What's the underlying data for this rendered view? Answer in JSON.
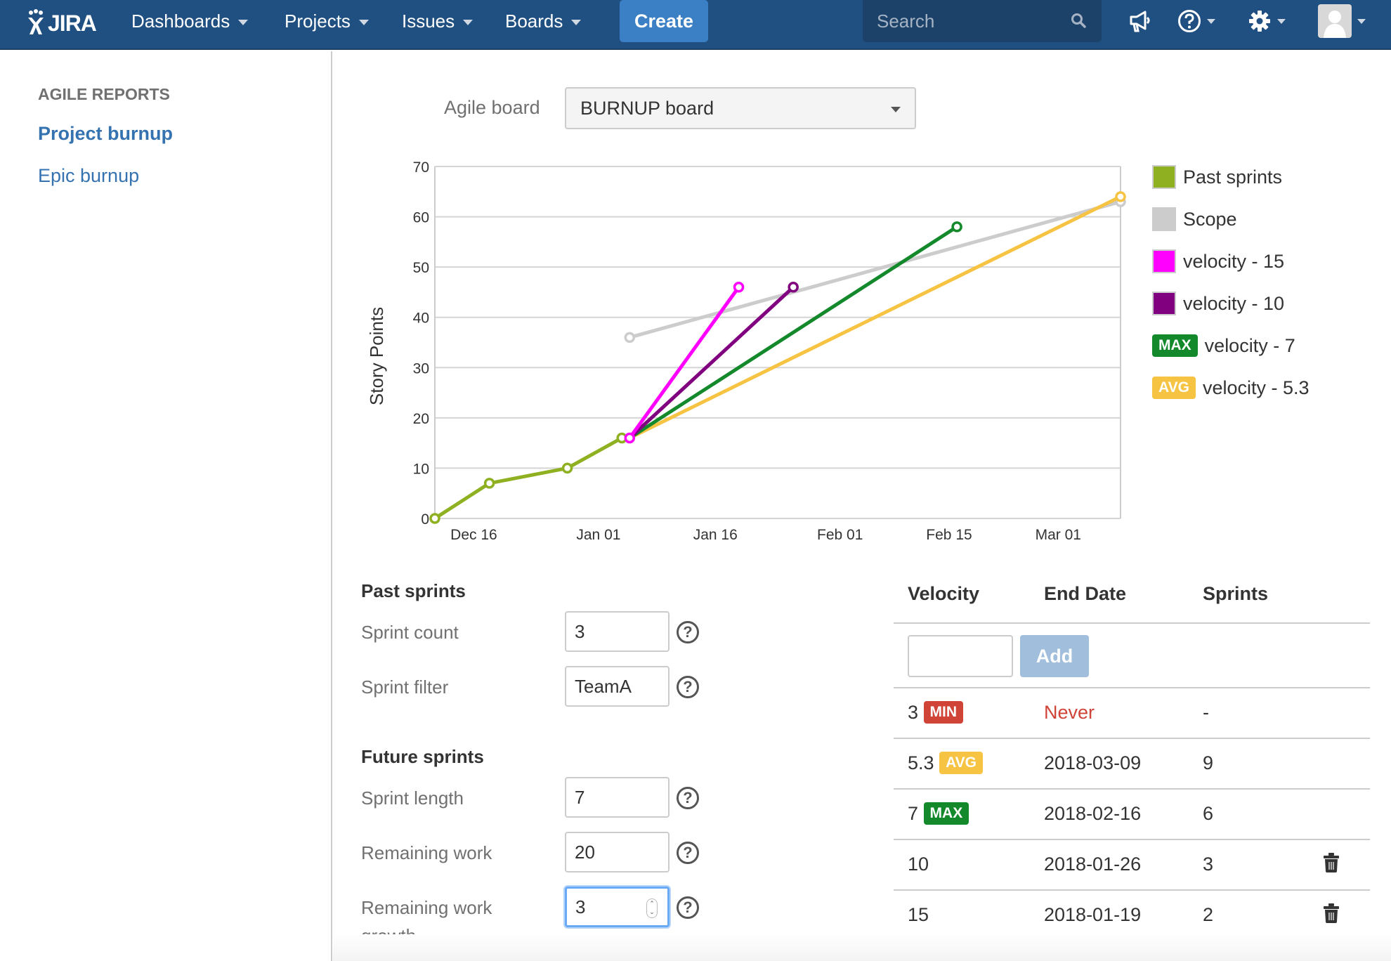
{
  "header": {
    "logo": "JIRA",
    "nav": [
      {
        "label": "Dashboards"
      },
      {
        "label": "Projects"
      },
      {
        "label": "Issues"
      },
      {
        "label": "Boards"
      }
    ],
    "create_label": "Create",
    "search_placeholder": "Search",
    "icons": [
      "megaphone-icon",
      "help-icon",
      "gear-icon",
      "avatar"
    ]
  },
  "sidebar": {
    "heading": "AGILE REPORTS",
    "items": [
      {
        "label": "Project burnup",
        "active": true
      },
      {
        "label": "Epic burnup",
        "active": false
      }
    ]
  },
  "board": {
    "label": "Agile board",
    "selected": "BURNUP board"
  },
  "legend": [
    {
      "label": "Past sprints",
      "color": "#8eb021"
    },
    {
      "label": "Scope",
      "color": "#cccccc"
    },
    {
      "label": "velocity - 15",
      "color": "#ff00ff"
    },
    {
      "label": "velocity - 10",
      "color": "#800080"
    },
    {
      "label": "velocity - 7",
      "badge": "MAX",
      "color": "#14892c"
    },
    {
      "label": "velocity - 5.3",
      "badge": "AVG",
      "color": "#f6c342"
    }
  ],
  "chart_data": {
    "type": "line",
    "title": "",
    "xlabel": "",
    "ylabel": "Story Points",
    "ylim": [
      0,
      70
    ],
    "yticks": [
      0,
      10,
      20,
      30,
      40,
      50,
      60,
      70
    ],
    "xlim": [
      "2017-12-11",
      "2018-03-09"
    ],
    "xticks": [
      {
        "label": "Dec 16",
        "date": "2017-12-16"
      },
      {
        "label": "Jan 01",
        "date": "2018-01-01"
      },
      {
        "label": "Jan 16",
        "date": "2018-01-16"
      },
      {
        "label": "Feb 01",
        "date": "2018-02-01"
      },
      {
        "label": "Feb 15",
        "date": "2018-02-15"
      },
      {
        "label": "Mar 01",
        "date": "2018-03-01"
      }
    ],
    "grid": true,
    "legend_position": "right",
    "series": [
      {
        "name": "Past sprints",
        "color": "#8eb021",
        "points": [
          [
            "2017-12-11",
            0
          ],
          [
            "2017-12-18",
            7
          ],
          [
            "2017-12-28",
            10
          ],
          [
            "2018-01-04",
            16
          ]
        ]
      },
      {
        "name": "Scope",
        "color": "#cccccc",
        "points": [
          [
            "2018-01-05",
            36
          ],
          [
            "2018-03-09",
            63
          ]
        ]
      },
      {
        "name": "velocity - 5.3",
        "color": "#f6c342",
        "points": [
          [
            "2018-01-05",
            16
          ],
          [
            "2018-03-09",
            64
          ]
        ]
      },
      {
        "name": "velocity - 7",
        "color": "#14892c",
        "points": [
          [
            "2018-01-05",
            16
          ],
          [
            "2018-02-16",
            58
          ]
        ]
      },
      {
        "name": "velocity - 10",
        "color": "#800080",
        "points": [
          [
            "2018-01-05",
            16
          ],
          [
            "2018-01-26",
            46
          ]
        ]
      },
      {
        "name": "velocity - 15",
        "color": "#ff00ff",
        "points": [
          [
            "2018-01-05",
            16
          ],
          [
            "2018-01-19",
            46
          ]
        ]
      }
    ]
  },
  "past_sprints": {
    "title": "Past sprints",
    "sprint_count": {
      "label": "Sprint count",
      "value": "3"
    },
    "sprint_filter": {
      "label": "Sprint filter",
      "value": "TeamA"
    }
  },
  "future_sprints": {
    "title": "Future sprints",
    "sprint_length": {
      "label": "Sprint length",
      "value": "7"
    },
    "remaining_work": {
      "label": "Remaining work",
      "value": "20"
    },
    "remaining_work_growth": {
      "label": "Remaining work growth",
      "value": "3"
    }
  },
  "velocity_table": {
    "headers": [
      "Velocity",
      "End Date",
      "Sprints"
    ],
    "add_label": "Add",
    "add_value": "",
    "rows": [
      {
        "velocity": "3",
        "badge": "MIN",
        "end_date": "Never",
        "sprints": "-",
        "deletable": false
      },
      {
        "velocity": "5.3",
        "badge": "AVG",
        "end_date": "2018-03-09",
        "sprints": "9",
        "deletable": false
      },
      {
        "velocity": "7",
        "badge": "MAX",
        "end_date": "2018-02-16",
        "sprints": "6",
        "deletable": false
      },
      {
        "velocity": "10",
        "badge": "",
        "end_date": "2018-01-26",
        "sprints": "3",
        "deletable": true
      },
      {
        "velocity": "15",
        "badge": "",
        "end_date": "2018-01-19",
        "sprints": "2",
        "deletable": true
      }
    ]
  }
}
